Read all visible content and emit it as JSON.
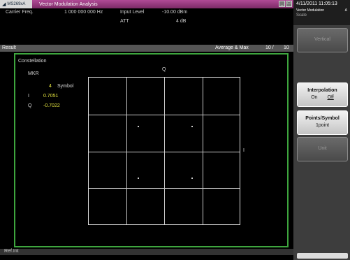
{
  "titlebar": {
    "logo_text": "MS269xA",
    "title": "Vector Modulation Analysis",
    "buttons": [
      "_",
      "□"
    ]
  },
  "measurement": {
    "carrier_label": "Carrier Freq.",
    "carrier_value": "1 000 000 000 Hz",
    "input_label": "Input Level",
    "input_value": "-10.00 dBm",
    "att_label": "ATT",
    "att_value": "4 dB"
  },
  "result_bar": {
    "label": "Result",
    "mode": "Average & Max",
    "count": "10 /",
    "total": "10"
  },
  "constellation": {
    "title": "Constellation",
    "mkr_label": "MKR",
    "symbol_count": "4",
    "symbol_label": "Symbol",
    "i_label": "I",
    "i_value": "0.7051",
    "q_label": "Q",
    "q_value": "-0.7022",
    "axis_q": "Q",
    "axis_i": "I"
  },
  "bottom_bar": {
    "label": "Ref.Int"
  },
  "sidebar": {
    "datetime": "4/11/2011 11:05:13",
    "mode": "Vector Modulation",
    "mode_marker": "A",
    "section": "Scale",
    "softkeys": [
      {
        "title": "Vertical",
        "active": false
      },
      {
        "title": "Interpolation",
        "options": [
          "On",
          "Off"
        ],
        "selected": "Off",
        "active": true
      },
      {
        "title": "Points/Symbol",
        "value": "1point",
        "active": true
      },
      {
        "title": "Unit",
        "active": false
      }
    ]
  }
}
